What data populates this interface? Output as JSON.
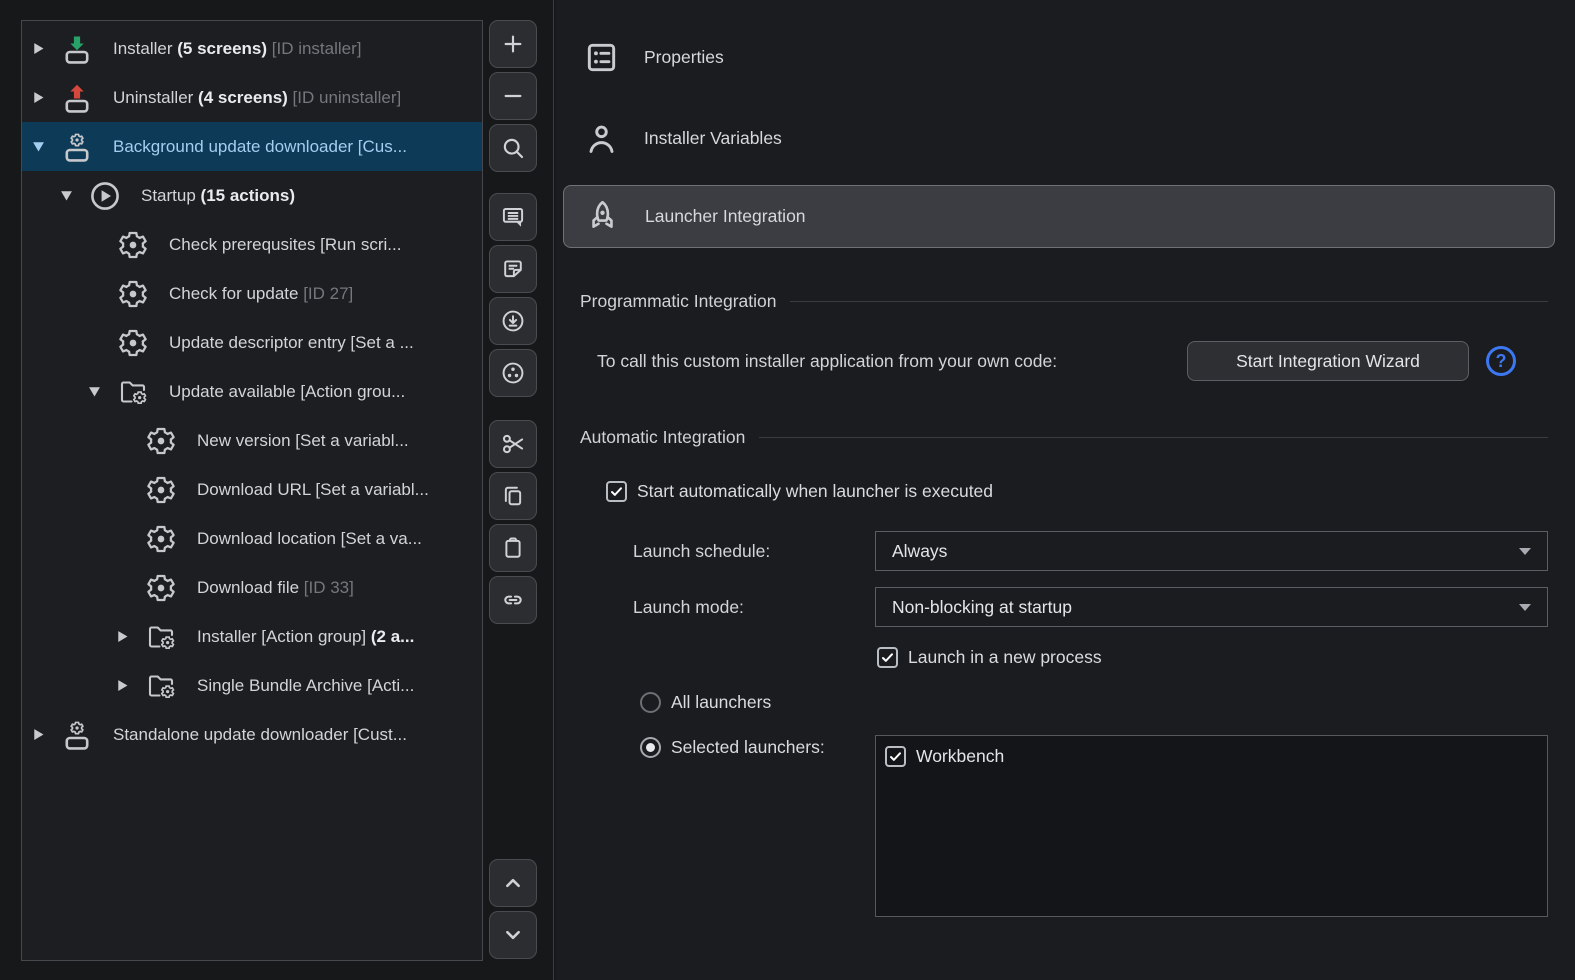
{
  "colors": {
    "selection_blue": "#0c3a57",
    "selected_text_blue": "#a5cdf0",
    "help_accent_blue": "#3b78f1",
    "installer_arrow_green": "#27a268",
    "uninstaller_arrow_red": "#d6473d"
  },
  "tree": {
    "rows": [
      {
        "level": 0,
        "expander": "right",
        "icon": "screen-down",
        "selected": false,
        "segments": [
          {
            "text": "Installer "
          },
          {
            "text": "(5 screens)",
            "style": "b"
          },
          {
            "text": " [ID installer]",
            "style": "d"
          }
        ]
      },
      {
        "level": 0,
        "expander": "right",
        "icon": "screen-up",
        "selected": false,
        "segments": [
          {
            "text": "Uninstaller "
          },
          {
            "text": "(4 screens)",
            "style": "b"
          },
          {
            "text": " [ID uninstaller]",
            "style": "d"
          }
        ]
      },
      {
        "level": 0,
        "expander": "down",
        "icon": "screen-gear",
        "selected": true,
        "segments": [
          {
            "text": "Background update downloader [Cus..."
          }
        ]
      },
      {
        "level": 1,
        "expander": "down",
        "icon": "play",
        "selected": false,
        "segments": [
          {
            "text": "Startup "
          },
          {
            "text": "(15 actions)",
            "style": "b"
          }
        ]
      },
      {
        "level": 2,
        "expander": null,
        "icon": "gear",
        "selected": false,
        "segments": [
          {
            "text": "Check prerequsites [Run scri..."
          }
        ]
      },
      {
        "level": 2,
        "expander": null,
        "icon": "gear",
        "selected": false,
        "segments": [
          {
            "text": "Check for update "
          },
          {
            "text": "[ID 27]",
            "style": "d"
          }
        ]
      },
      {
        "level": 2,
        "expander": null,
        "icon": "gear",
        "selected": false,
        "segments": [
          {
            "text": "Update descriptor entry [Set a ..."
          }
        ]
      },
      {
        "level": 2,
        "expander": "down",
        "icon": "folder-gear",
        "selected": false,
        "segments": [
          {
            "text": "Update available [Action grou..."
          }
        ]
      },
      {
        "level": 3,
        "expander": null,
        "icon": "gear",
        "selected": false,
        "segments": [
          {
            "text": "New version [Set a variabl..."
          }
        ]
      },
      {
        "level": 3,
        "expander": null,
        "icon": "gear",
        "selected": false,
        "segments": [
          {
            "text": "Download URL [Set a variabl..."
          }
        ]
      },
      {
        "level": 3,
        "expander": null,
        "icon": "gear",
        "selected": false,
        "segments": [
          {
            "text": "Download location [Set a va..."
          }
        ]
      },
      {
        "level": 3,
        "expander": null,
        "icon": "gear",
        "selected": false,
        "segments": [
          {
            "text": "Download file "
          },
          {
            "text": "[ID 33]",
            "style": "d"
          }
        ]
      },
      {
        "level": 3,
        "expander": "right",
        "icon": "folder-gear",
        "selected": false,
        "segments": [
          {
            "text": "Installer [Action group] "
          },
          {
            "text": "(2 a...",
            "style": "b"
          }
        ]
      },
      {
        "level": 3,
        "expander": "right",
        "icon": "folder-gear",
        "selected": false,
        "segments": [
          {
            "text": "Single Bundle Archive [Acti..."
          }
        ]
      },
      {
        "level": 0,
        "expander": "right",
        "icon": "screen-gear",
        "selected": false,
        "segments": [
          {
            "text": "Standalone update downloader [Cust..."
          }
        ]
      }
    ]
  },
  "toolbar": {
    "buttons": [
      {
        "name": "add-button",
        "icon": "plus"
      },
      {
        "name": "remove-button",
        "icon": "minus"
      },
      {
        "name": "search-button",
        "icon": "magnifier"
      },
      {
        "name": "comments-button",
        "icon": "speech-bubble"
      },
      {
        "name": "screen-comment-button",
        "icon": "note"
      },
      {
        "name": "download-action-button",
        "icon": "download-circle"
      },
      {
        "name": "action-group-button",
        "icon": "dots-circle"
      },
      {
        "name": "cut-button",
        "icon": "scissors"
      },
      {
        "name": "copy-button",
        "icon": "copy"
      },
      {
        "name": "paste-button",
        "icon": "clipboard"
      },
      {
        "name": "link-button",
        "icon": "link"
      },
      {
        "name": "move-up-button",
        "icon": "chevron-up"
      },
      {
        "name": "move-down-button",
        "icon": "chevron-down"
      }
    ]
  },
  "panel": {
    "tabs": [
      {
        "label": "Properties",
        "icon": "form",
        "selected": false
      },
      {
        "label": "Installer Variables",
        "icon": "person",
        "selected": false
      },
      {
        "label": "Launcher Integration",
        "icon": "rocket",
        "selected": true
      }
    ],
    "programmatic": {
      "title": "Programmatic Integration",
      "call_label": "To call this custom installer application from your own code:",
      "wizard_button": "Start Integration Wizard",
      "help_label": "?"
    },
    "automatic": {
      "title": "Automatic Integration",
      "start_auto_label": "Start automatically when launcher is executed",
      "start_auto_checked": true,
      "launch_schedule_label": "Launch schedule:",
      "launch_schedule_value": "Always",
      "launch_mode_label": "Launch mode:",
      "launch_mode_value": "Non-blocking at startup",
      "new_process_label": "Launch in a new process",
      "new_process_checked": true,
      "all_launchers_label": "All launchers",
      "all_launchers_selected": false,
      "selected_launchers_label": "Selected launchers:",
      "selected_launchers_selected": true,
      "launchers": [
        {
          "label": "Workbench",
          "checked": true
        }
      ]
    }
  }
}
